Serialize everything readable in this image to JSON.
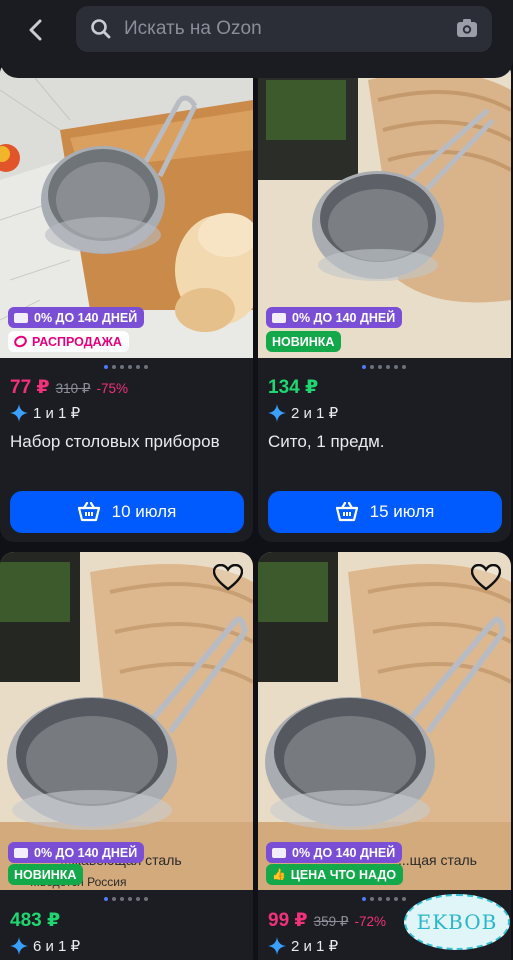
{
  "search": {
    "placeholder": "Искать на Ozon"
  },
  "icons": {
    "back": "chevron-left-icon",
    "search": "search-icon",
    "camera": "camera-icon",
    "cart": "cart-icon",
    "star": "sparkle-star-icon",
    "heart": "heart-icon"
  },
  "colors": {
    "accent": "#005bff",
    "sale_price": "#f2317b",
    "price_green": "#1fd670",
    "credit": "#7a4fd6",
    "new": "#13a84a"
  },
  "products": [
    {
      "badges": [
        "0% ДО 140 ДНЕЙ",
        "РАСПРОДАЖА"
      ],
      "price": "77 ₽",
      "old_price": "310 ₽",
      "discount": "-75%",
      "rating": "1 и 1 ₽",
      "title": "Набор столовых приборов",
      "delivery": "10 июля"
    },
    {
      "badges": [
        "0% ДО 140 ДНЕЙ",
        "НОВИНКА"
      ],
      "price": "134 ₽",
      "rating": "2 и 1 ₽",
      "title": "Сито, 1 предм.",
      "delivery": "15 июля"
    },
    {
      "badges": [
        "0% ДО 140 ДНЕЙ",
        "НОВИНКА"
      ],
      "photo_text": [
        "...жавеющая сталь",
        "...ведется Россия"
      ],
      "price": "483 ₽",
      "rating": "6 и 1 ₽"
    },
    {
      "badges": [
        "0% ДО 140 ДНЕЙ",
        "ЦЕНА ЧТО НАДО"
      ],
      "photo_text": [
        "...щая сталь"
      ],
      "price": "99 ₽",
      "old_price": "359 ₽",
      "discount": "-72%",
      "rating": "2 и 1 ₽"
    }
  ],
  "watermark": "EKBOB"
}
